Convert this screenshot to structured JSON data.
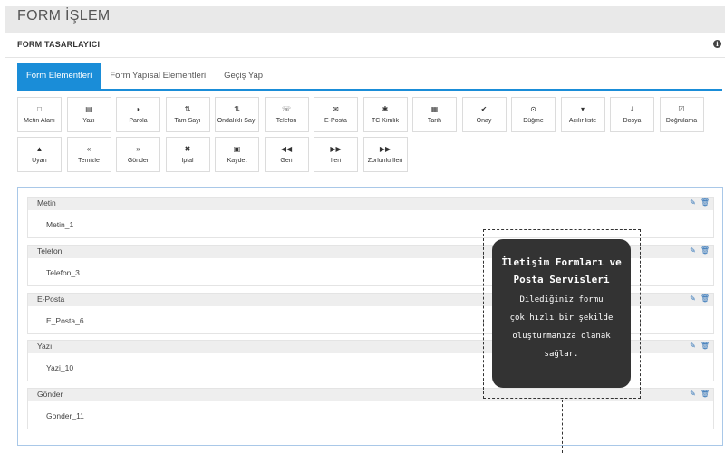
{
  "page": {
    "title": "FORM İŞLEM"
  },
  "panel": {
    "title": "FORM TASARLAYICI",
    "info_icon": "info-circle-icon"
  },
  "tabs": [
    {
      "label": "Form Elementleri",
      "active": true
    },
    {
      "label": "Form Yapısal Elementleri",
      "active": false
    },
    {
      "label": "Geçiş Yap",
      "active": false
    }
  ],
  "palette": [
    {
      "label": "Metin Alanı",
      "icon": "□",
      "icon_name": "square-icon"
    },
    {
      "label": "Yazı",
      "icon": "▤",
      "icon_name": "file-text-icon"
    },
    {
      "label": "Parola",
      "icon": "◗",
      "icon_name": "shield-icon"
    },
    {
      "label": "Tam Sayı",
      "icon": "⇅",
      "icon_name": "sort-numeric-icon"
    },
    {
      "label": "Ondalıklı Sayı",
      "icon": "⇅",
      "icon_name": "sort-decimal-icon"
    },
    {
      "label": "Telefon",
      "icon": "☏",
      "icon_name": "phone-icon"
    },
    {
      "label": "E-Posta",
      "icon": "✉",
      "icon_name": "envelope-icon"
    },
    {
      "label": "TC Kimlik",
      "icon": "✱",
      "icon_name": "asterisk-icon"
    },
    {
      "label": "Tarih",
      "icon": "▦",
      "icon_name": "calendar-icon"
    },
    {
      "label": "Onay",
      "icon": "✔",
      "icon_name": "check-icon"
    },
    {
      "label": "Düğme",
      "icon": "⊙",
      "icon_name": "dot-circle-icon"
    },
    {
      "label": "Açılır liste",
      "icon": "▾",
      "icon_name": "caret-down-icon"
    },
    {
      "label": "Dosya",
      "icon": "⤓",
      "icon_name": "download-icon"
    },
    {
      "label": "Doğrulama",
      "icon": "☑",
      "icon_name": "check-square-icon"
    },
    {
      "label": "Uyarı",
      "icon": "▲",
      "icon_name": "warning-icon"
    },
    {
      "label": "Temizle",
      "icon": "«",
      "icon_name": "angle-double-left-icon"
    },
    {
      "label": "Gönder",
      "icon": "»",
      "icon_name": "angle-double-right-icon"
    },
    {
      "label": "İptal",
      "icon": "✖",
      "icon_name": "times-icon"
    },
    {
      "label": "Kaydet",
      "icon": "▣",
      "icon_name": "save-icon"
    },
    {
      "label": "Geri",
      "icon": "◀◀",
      "icon_name": "backward-icon"
    },
    {
      "label": "İleri",
      "icon": "▶▶",
      "icon_name": "forward-icon"
    },
    {
      "label": "Zorlunlu İleri",
      "icon": "▶▶",
      "icon_name": "fast-forward-icon"
    }
  ],
  "fields": [
    {
      "label": "Metin",
      "value": "Metin_1"
    },
    {
      "label": "Telefon",
      "value": "Telefon_3"
    },
    {
      "label": "E-Posta",
      "value": "E_Posta_6"
    },
    {
      "label": "Yazı",
      "value": "Yazi_10"
    },
    {
      "label": "Gönder",
      "value": "Gonder_11"
    }
  ],
  "field_actions": {
    "edit_icon": "✎",
    "delete_icon": "🗑"
  },
  "tooltip": {
    "title_line1": "İletişim Formları ve",
    "title_line2": "Posta Servisleri",
    "text_line1": "Dilediğiniz formu",
    "text_line2": "çok hızlı bir şekilde",
    "text_line3": "oluşturmanıza olanak",
    "text_line4": "sağlar."
  },
  "colors": {
    "accent": "#1a8dd8",
    "tooltip_bg": "#333333",
    "action_icon": "#2a6fb5"
  }
}
